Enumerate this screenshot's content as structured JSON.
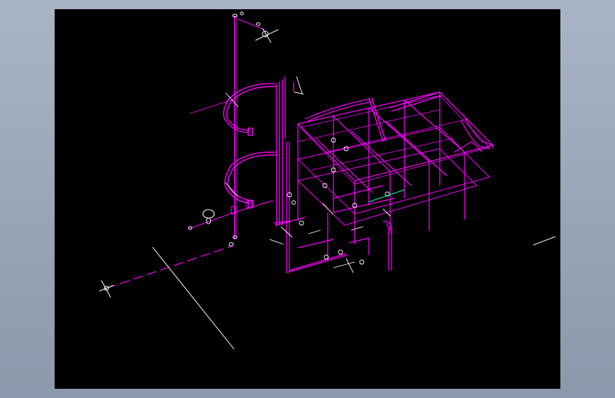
{
  "viewer": {
    "background_color": "#97a3b6",
    "canvas_color": "#000000"
  },
  "drawing": {
    "kind": "isometric pipe and frame model",
    "colors": {
      "structure": "#ff00ff",
      "annotation": "#ffffff",
      "accent": "#00ffcc"
    }
  }
}
